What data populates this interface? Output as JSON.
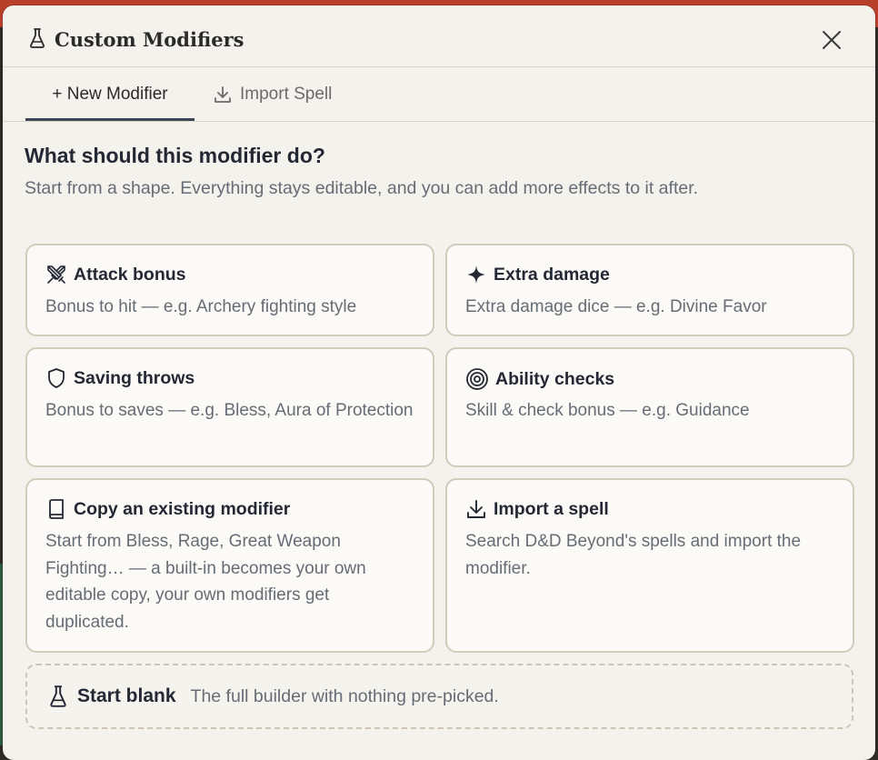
{
  "dialog": {
    "title": "Custom Modifiers",
    "title_icon": "flask-icon",
    "close_icon": "close-icon"
  },
  "tabs": [
    {
      "label": "+ New Modifier",
      "active": true
    },
    {
      "label": "Import Spell",
      "icon": "download-icon",
      "active": false
    }
  ],
  "main": {
    "heading": "What should this modifier do?",
    "subheading": "Start from a shape. Everything stays editable, and you can add more effects to it after."
  },
  "cards": [
    {
      "title": "Attack bonus",
      "icon": "crossed-swords-icon",
      "description": "Bonus to hit — e.g. Archery fighting style"
    },
    {
      "title": "Extra damage",
      "icon": "sparkle-icon",
      "description": "Extra damage dice — e.g. Divine Favor"
    },
    {
      "title": "Saving throws",
      "icon": "shield-icon",
      "description": "Bonus to saves — e.g. Bless, Aura of Protection"
    },
    {
      "title": "Ability checks",
      "icon": "target-icon",
      "description": "Skill & check bonus — e.g. Guidance"
    },
    {
      "title": "Copy an existing modifier",
      "icon": "book-icon",
      "description": "Start from Bless, Rage, Great Weapon Fighting… — a built-in becomes your own editable copy, your own modifiers get duplicated."
    },
    {
      "title": "Import a spell",
      "icon": "download-icon",
      "description": "Search D&D Beyond's spells and import the modifier."
    }
  ],
  "blank": {
    "title": "Start blank",
    "icon": "flask-icon",
    "description": "The full builder with nothing pre-picked."
  },
  "colors": {
    "text_primary": "#232834",
    "text_secondary": "#666c76",
    "card_border": "#d2ccbb",
    "background": "#f4f2ec",
    "tab_underline": "#3d4654"
  }
}
